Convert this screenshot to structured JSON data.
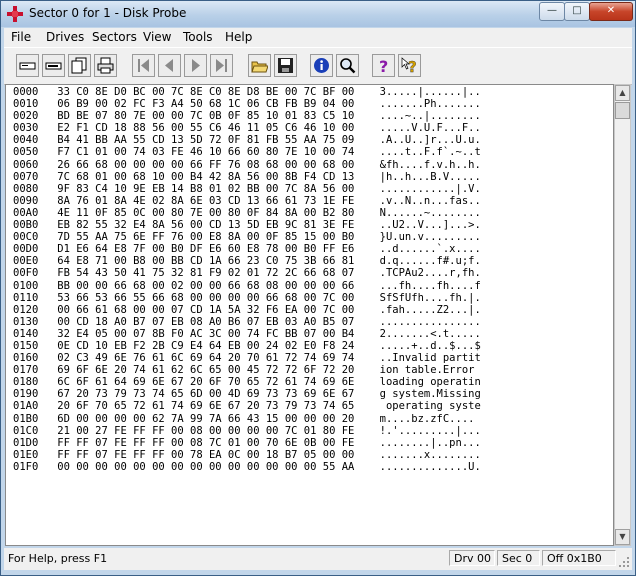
{
  "window": {
    "title": "Sector 0 for 1 - Disk Probe"
  },
  "title_buttons": {
    "minimize": "—",
    "maximize": "□",
    "close": "✕"
  },
  "menu": [
    "File",
    "Drives",
    "Sectors",
    "View",
    "Tools",
    "Help"
  ],
  "toolbar": {
    "buttons": [
      "drive-icon",
      "volume-icon",
      "copy-sector-icon",
      "print-icon",
      "first-sector-icon",
      "prev-sector-icon",
      "next-sector-icon",
      "last-sector-icon",
      "open-file-icon",
      "save-icon",
      "info-icon",
      "search-icon",
      "help-icon",
      "context-help-icon"
    ]
  },
  "dump": {
    "lines": [
      "0000   33 C0 8E D0 BC 00 7C 8E C0 8E D8 BE 00 7C BF 00    3.....|......|..",
      "0010   06 B9 00 02 FC F3 A4 50 68 1C 06 CB FB B9 04 00    .......Ph.......",
      "0020   BD BE 07 80 7E 00 00 7C 0B 0F 85 10 01 83 C5 10    ....~..|........",
      "0030   E2 F1 CD 18 88 56 00 55 C6 46 11 05 C6 46 10 00    .....V.U.F...F..",
      "0040   B4 41 BB AA 55 CD 13 5D 72 0F 81 FB 55 AA 75 09    .A..U..]r...U.u.",
      "0050   F7 C1 01 00 74 03 FE 46 10 66 60 80 7E 10 00 74    ....t..F.f`.~..t",
      "0060   26 66 68 00 00 00 00 66 FF 76 08 68 00 00 68 00    &fh....f.v.h..h.",
      "0070   7C 68 01 00 68 10 00 B4 42 8A 56 00 8B F4 CD 13    |h..h...B.V.....",
      "0080   9F 83 C4 10 9E EB 14 B8 01 02 BB 00 7C 8A 56 00    ............|.V.",
      "0090   8A 76 01 8A 4E 02 8A 6E 03 CD 13 66 61 73 1E FE    .v..N..n...fas..",
      "00A0   4E 11 0F 85 0C 00 80 7E 00 80 0F 84 8A 00 B2 80    N......~........",
      "00B0   EB 82 55 32 E4 8A 56 00 CD 13 5D EB 9C 81 3E FE    ..U2..V...]...>.",
      "00C0   7D 55 AA 75 6E FF 76 00 E8 8A 00 0F 85 15 00 B0    }U.un.v.........",
      "00D0   D1 E6 64 E8 7F 00 B0 DF E6 60 E8 78 00 B0 FF E6    ..d......`.x....",
      "00E0   64 E8 71 00 B8 00 BB CD 1A 66 23 C0 75 3B 66 81    d.q......f#.u;f.",
      "00F0   FB 54 43 50 41 75 32 81 F9 02 01 72 2C 66 68 07    .TCPAu2....r,fh.",
      "0100   BB 00 00 66 68 00 02 00 00 66 68 08 00 00 00 66    ...fh....fh....f",
      "0110   53 66 53 66 55 66 68 00 00 00 00 66 68 00 7C 00    SfSfUfh....fh.|.",
      "0120   00 66 61 68 00 00 07 CD 1A 5A 32 F6 EA 00 7C 00    .fah.....Z2...|.",
      "0130   00 CD 18 A0 B7 07 EB 08 A0 B6 07 EB 03 A0 B5 07    ................",
      "0140   32 E4 05 00 07 8B F0 AC 3C 00 74 FC BB 07 00 B4    2.......<.t.....",
      "0150   0E CD 10 EB F2 2B C9 E4 64 EB 00 24 02 E0 F8 24    .....+..d..$...$",
      "0160   02 C3 49 6E 76 61 6C 69 64 20 70 61 72 74 69 74    ..Invalid partit",
      "0170   69 6F 6E 20 74 61 62 6C 65 00 45 72 72 6F 72 20    ion table.Error ",
      "0180   6C 6F 61 64 69 6E 67 20 6F 70 65 72 61 74 69 6E    loading operatin",
      "0190   67 20 73 79 73 74 65 6D 00 4D 69 73 73 69 6E 67    g system.Missing",
      "01A0   20 6F 70 65 72 61 74 69 6E 67 20 73 79 73 74 65     operating syste",
      "01B0   6D 00 00 00 00 62 7A 99 7A 66 43 15 00 00 00 20    m....bz.zfC.... ",
      "01C0   21 00 27 FE FF FF 00 08 00 00 00 00 7C 01 80 FE    !.'.........|...",
      "01D0   FF FF 07 FE FF FF 00 08 7C 01 00 70 6E 0B 00 FE    ........|..pn...",
      "01E0   FF FF 07 FE FF FF 00 78 EA 0C 00 18 B7 05 00 00    .......x........",
      "01F0   00 00 00 00 00 00 00 00 00 00 00 00 00 00 55 AA    ..............U."
    ]
  },
  "statusbar": {
    "help_text": "For Help, press F1",
    "drive": "Drv  00",
    "sector": "Sec 0",
    "offset": "Off 0x1B0"
  },
  "colors": {
    "title_gradient": "#b9d0e8",
    "close_button": "#c7452a",
    "info_blue": "#1a3fb8",
    "help_purple": "#8a1aa8"
  }
}
